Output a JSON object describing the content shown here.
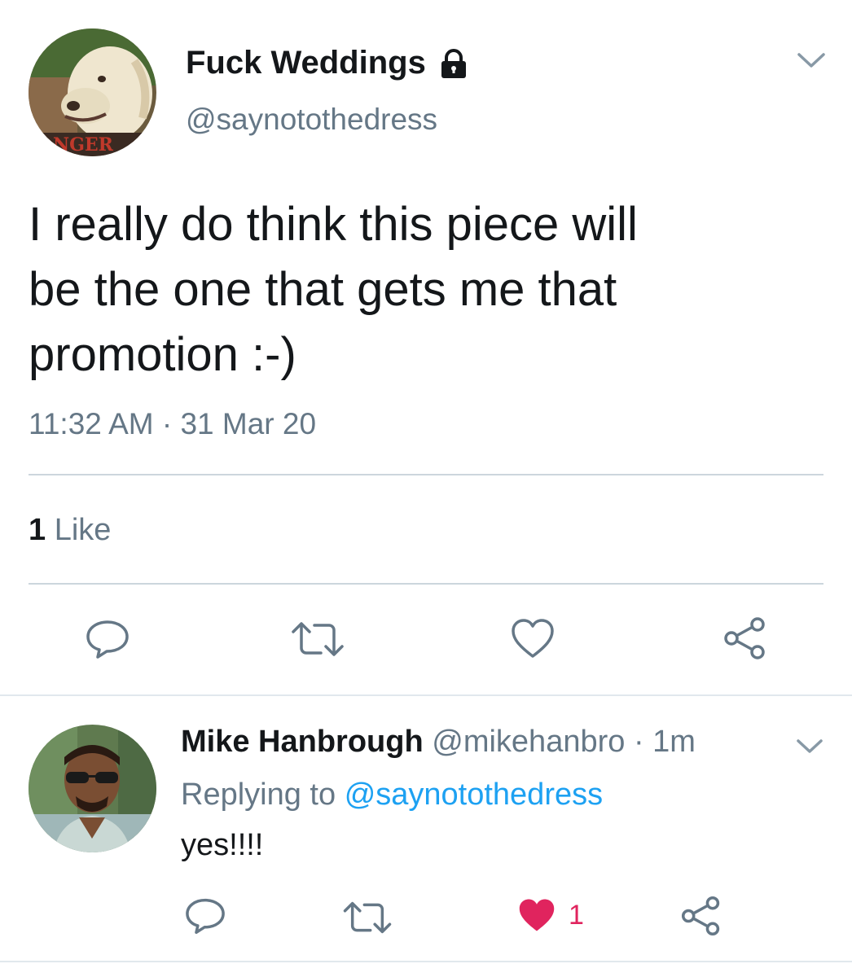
{
  "main_tweet": {
    "display_name": "Fuck Weddings",
    "handle": "@saynotothedress",
    "avatar_text": "NGER",
    "text": "I really do think this piece will\nbe the one that gets me that\npromotion :-)",
    "timestamp": "11:32 AM · 31 Mar 20",
    "likes_count": "1",
    "likes_label": "Like",
    "icons": {
      "lock": "lock-icon",
      "menu": "chevron-down-icon",
      "reply": "speech-bubble-icon",
      "retweet": "retweet-icon",
      "like": "heart-outline-icon",
      "share": "share-icon"
    }
  },
  "reply_tweet": {
    "display_name": "Mike Hanbrough",
    "handle": "@mikehanbro",
    "separator": "·",
    "time_ago": "1m",
    "replying_prefix": "Replying to",
    "replying_to": "@saynotothedress",
    "text": "yes!!!!",
    "like_count": "1",
    "liked": true,
    "icons": {
      "menu": "chevron-down-icon",
      "reply": "speech-bubble-icon",
      "retweet": "retweet-icon",
      "like": "heart-filled-icon",
      "share": "share-icon"
    }
  },
  "colors": {
    "text": "#14171a",
    "secondary": "#657786",
    "link": "#1da1f2",
    "like": "#e0245e",
    "divider": "#ccd6dd"
  }
}
